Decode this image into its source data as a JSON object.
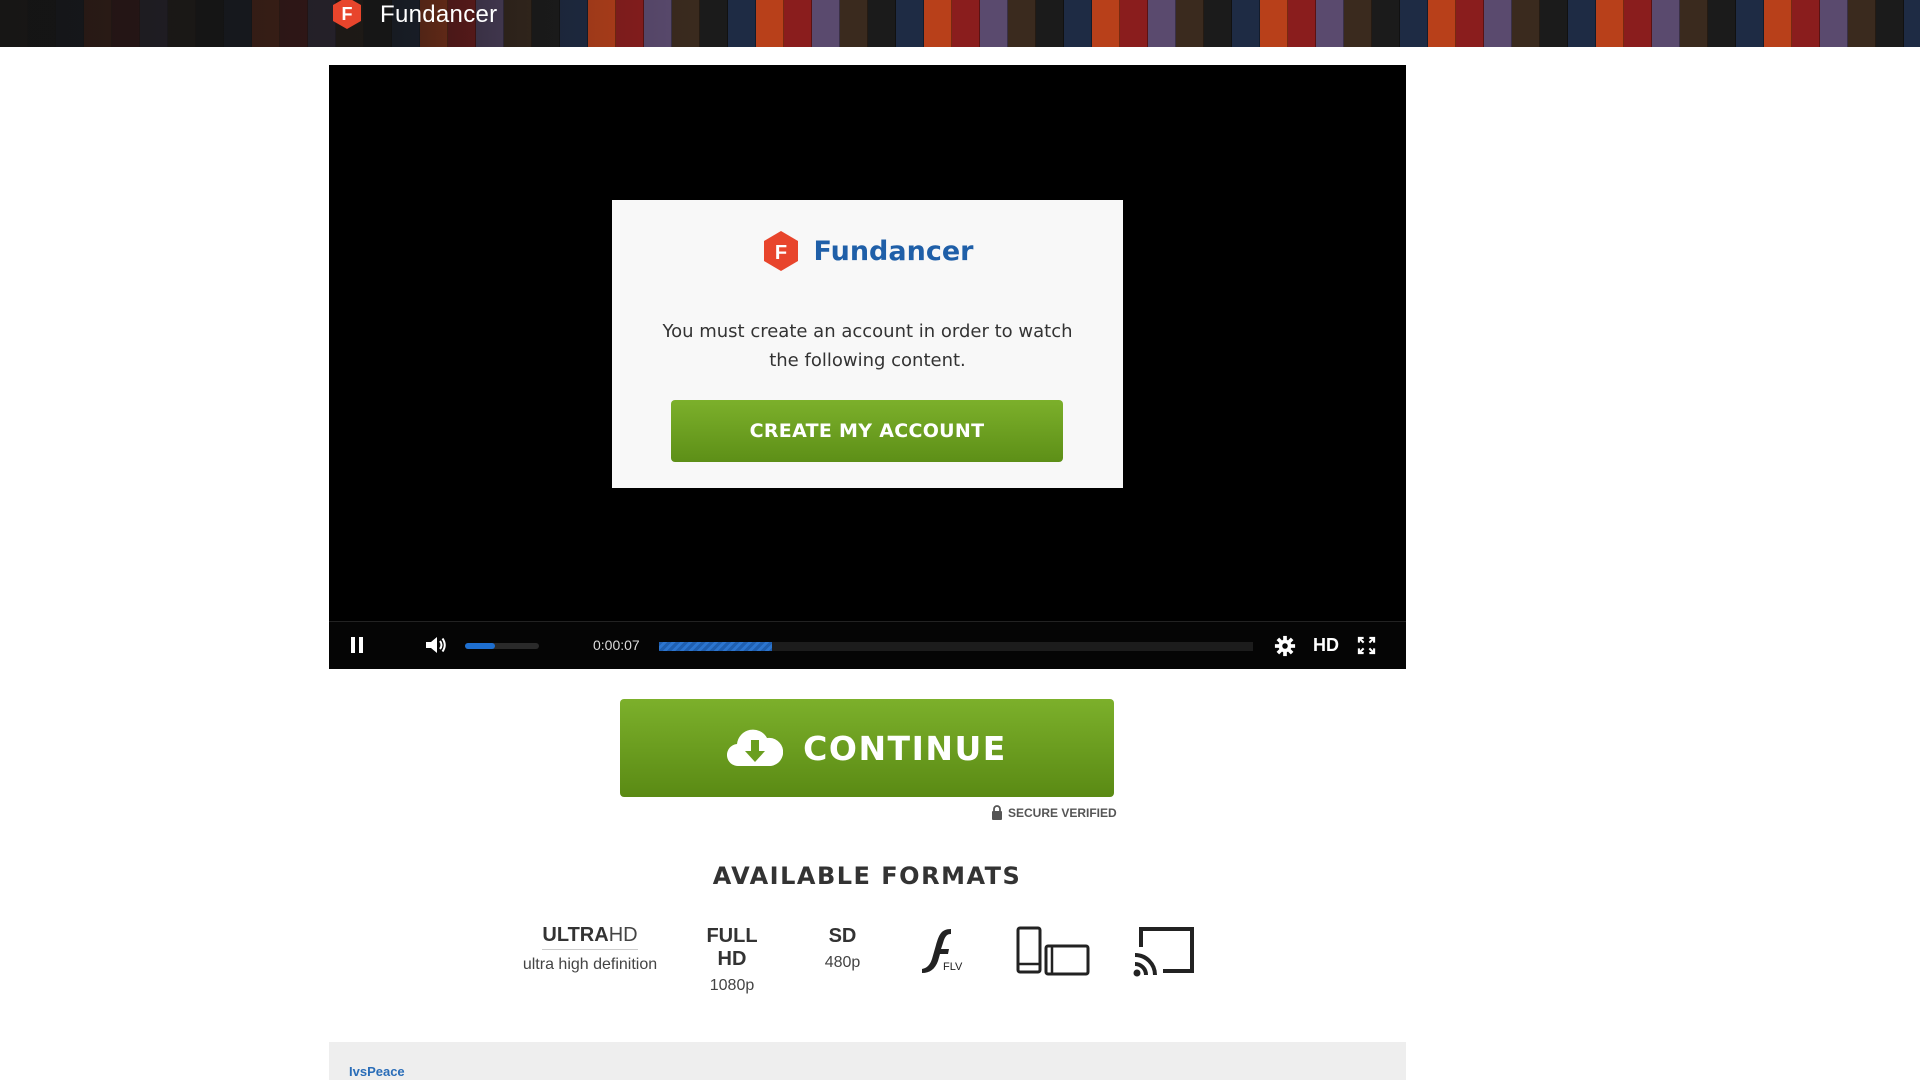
{
  "header": {
    "brand_name": "Fundancer"
  },
  "player": {
    "modal": {
      "brand_name": "Fundancer",
      "message": "You must create an account in order to watch the following content.",
      "create_button": "CREATE MY ACCOUNT"
    },
    "controls": {
      "time": "0:00:07",
      "quality": "HD",
      "volume_fraction": 0.4,
      "progress_fraction": 0.19
    }
  },
  "continue": {
    "label": "CONTINUE",
    "secure_text": "SECURE VERIFIED"
  },
  "formats": {
    "title": "AVAILABLE FORMATS",
    "ultra": {
      "bold": "ULTRA",
      "thin": "HD",
      "sub": "ultra high definition"
    },
    "full": {
      "label": "FULL HD",
      "sub": "1080p"
    },
    "sd": {
      "label": "SD",
      "sub": "480p"
    },
    "flv": {
      "label": "FLV"
    }
  },
  "comments": {
    "first_user": "IvsPeace"
  },
  "colors": {
    "accent_green": "#6a9e1f",
    "brand_blue": "#1f5fa8",
    "brand_red": "#e8452c"
  }
}
